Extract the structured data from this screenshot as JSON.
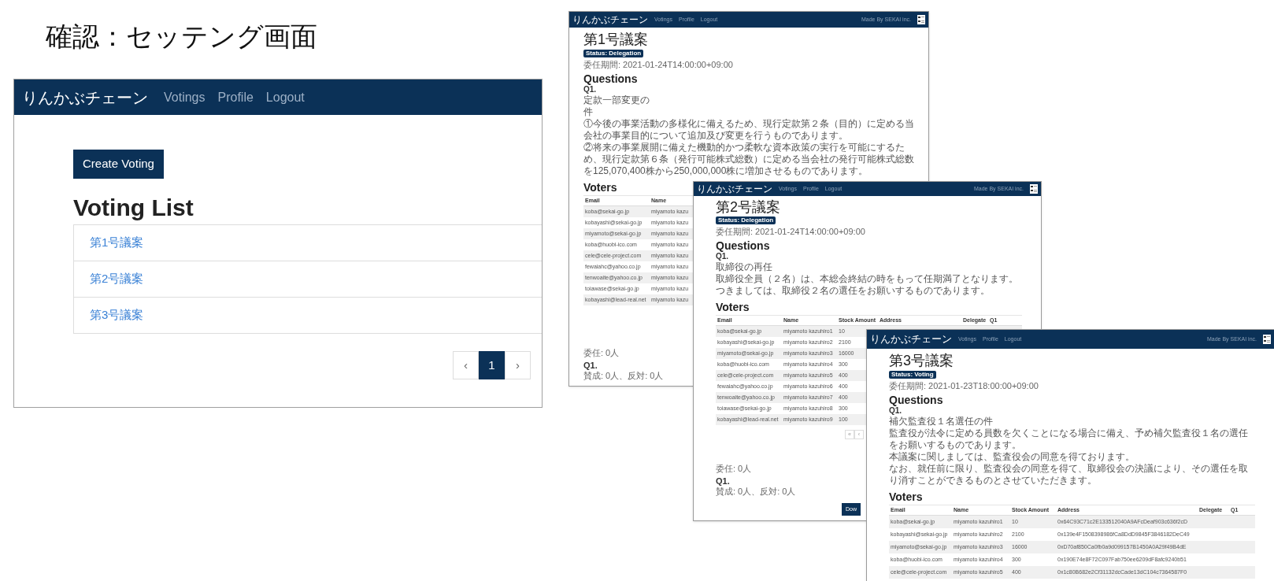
{
  "slide_title": "確認：セッテング画面",
  "list_window": {
    "brand": "りんかぶチェーン",
    "nav": [
      "Votings",
      "Profile",
      "Logout"
    ],
    "create_button": "Create Voting",
    "heading": "Voting List",
    "items": [
      "第1号議案",
      "第2号議案",
      "第3号議案"
    ],
    "pagination": [
      {
        "label": "‹",
        "selected": false
      },
      {
        "label": "1",
        "selected": true
      },
      {
        "label": "›",
        "selected": false
      }
    ]
  },
  "detail_windows": [
    {
      "brand": "りんかぶチェーン",
      "nav": [
        "Votings",
        "Profile",
        "Logout"
      ],
      "credit": "Made By SEKAI inc.",
      "title": "第1号議案",
      "status": "Status: Delegation",
      "period": "委任期間: 2021-01-24T14:00:00+09:00",
      "questions_heading": "Questions",
      "question_label": "Q1.",
      "question_lines": [
        "定款一部変更の",
        "件",
        "①今後の事業活動の多様化に備えるため、現行定款第２条（目的）に定める当会社の事業目的について追加及び変更を行うものであります。",
        "②将来の事業展開に備えた機動的かつ柔軟な資本政策の実行を可能にするため、現行定款第６条（発行可能株式総数）に定める当会社の発行可能株式総数を125,070,400株から250,000,000株に増加させるものであります。"
      ],
      "voters_heading": "Voters",
      "columns": [
        "Email",
        "Name"
      ],
      "rows": [
        [
          "koba@sekai-go.jp",
          "miyamoto kazu"
        ],
        [
          "kobayashi@sekai-go.jp",
          "miyamoto kazu"
        ],
        [
          "miyamoto@sekai-go.jp",
          "miyamoto kazu"
        ],
        [
          "koba@huobi-ico.com",
          "miyamoto kazu"
        ],
        [
          "cele@cele-project.com",
          "miyamoto kazu"
        ],
        [
          "fewaiahc@yahoo.co.jp",
          "miyamoto kazu"
        ],
        [
          "tenwoaite@yahoo.co.jp",
          "miyamoto kazu"
        ],
        [
          "toiawase@sekai-go.jp",
          "miyamoto kazu"
        ],
        [
          "kobayashi@lead-real.net",
          "miyamoto kazu"
        ]
      ],
      "summary": {
        "delegation": "委任: 0人",
        "question": "Q1.",
        "tally": "賛成: 0人、反対: 0人"
      }
    },
    {
      "brand": "りんかぶチェーン",
      "nav": [
        "Votings",
        "Profile",
        "Logout"
      ],
      "credit": "Made By SEKAI inc.",
      "title": "第2号議案",
      "status": "Status: Delegation",
      "period": "委任期間: 2021-01-24T14:00:00+09:00",
      "questions_heading": "Questions",
      "question_label": "Q1.",
      "question_lines": [
        "取締役の再任",
        "取締役全員（２名）は、本総会終結の時をもって任期満了となります。つきましては、取締役２名の選任をお願いするものであります。"
      ],
      "voters_heading": "Voters",
      "columns": [
        "Email",
        "Name",
        "Stock Amount",
        "Address",
        "Delegate",
        "Q1"
      ],
      "rows": [
        [
          "koba@sekai-go.jp",
          "miyamoto kazuhiro1",
          "10"
        ],
        [
          "kobayashi@sekai-go.jp",
          "miyamoto kazuhiro2",
          "2100"
        ],
        [
          "miyamoto@sekai-go.jp",
          "miyamoto kazuhiro3",
          "16000"
        ],
        [
          "koba@huobi-ico.com",
          "miyamoto kazuhiro4",
          "300"
        ],
        [
          "cele@cele-project.com",
          "miyamoto kazuhiro5",
          "400"
        ],
        [
          "fewaiahc@yahoo.co.jp",
          "miyamoto kazuhiro6",
          "400"
        ],
        [
          "tenwoaite@yahoo.co.jp",
          "miyamoto kazuhiro7",
          "400"
        ],
        [
          "toiawase@sekai-go.jp",
          "miyamoto kazuhiro8",
          "300"
        ],
        [
          "kobayashi@lead-real.net",
          "miyamoto kazuhiro9",
          "100"
        ]
      ],
      "pagination": [
        "«",
        "‹"
      ],
      "summary": {
        "delegation": "委任: 0人",
        "question": "Q1.",
        "tally": "賛成: 0人、反対: 0人"
      },
      "button": "Dow"
    },
    {
      "brand": "りんかぶチェーン",
      "nav": [
        "Votings",
        "Profile",
        "Logout"
      ],
      "credit": "Made By SEKAI inc.",
      "title": "第3号議案",
      "status": "Status: Voting",
      "period": "委任期間: 2021-01-23T18:00:00+09:00",
      "questions_heading": "Questions",
      "question_label": "Q1.",
      "question_lines": [
        "補欠監査役１名選任の件",
        "監査役が法令に定める員数を欠くことになる場合に備え、予め補欠監査役１名の選任をお願いするものであります。",
        "本議案に関しましては、監査役会の同意を得ております。",
        "なお、就任前に限り、監査役会の同意を得て、取締役会の決議により、その選任を取り消すことができるものとさせていただきます。"
      ],
      "voters_heading": "Voters",
      "columns": [
        "Email",
        "Name",
        "Stock Amount",
        "Address",
        "Delegate",
        "Q1"
      ],
      "rows": [
        [
          "koba@sekai-go.jp",
          "miyamoto kazuhiro1",
          "10",
          "0x64C93C71c2E133512040A9AFcDeaf903c636f2cD"
        ],
        [
          "kobayashi@sekai-go.jp",
          "miyamoto kazuhiro2",
          "2100",
          "0x139e4F1508398986fCa8DdD9845F3846182DeC49"
        ],
        [
          "miyamoto@sekai-go.jp",
          "miyamoto kazuhiro3",
          "16000",
          "0xD70af850Ca0fb0a9d099157B1450A0A29f49B4dE"
        ],
        [
          "koba@huobi-ico.com",
          "miyamoto kazuhiro4",
          "300",
          "0x190E74e8F72C097Fab750ee6209dF8afc9240b51"
        ],
        [
          "cele@cele-project.com",
          "miyamoto kazuhiro5",
          "400",
          "0x1c80B682e2Cf31132dcCade13dC104c7364587F0"
        ]
      ]
    }
  ]
}
